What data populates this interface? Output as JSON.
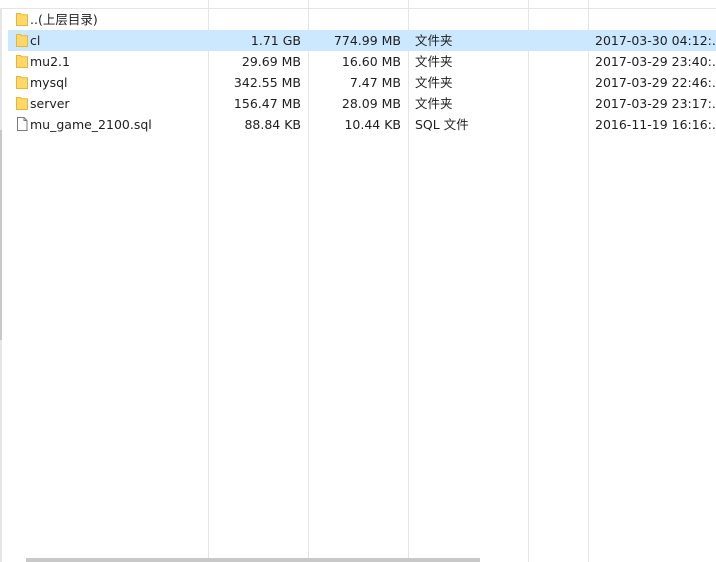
{
  "files": [
    {
      "name": "..(上层目录)",
      "size": "",
      "packed": "",
      "type": "",
      "modified": "",
      "icon": "folder-icon"
    },
    {
      "name": "cl",
      "size": "1.71 GB",
      "packed": "774.99 MB",
      "type": "文件夹",
      "modified": "2017-03-30 04:12:...",
      "icon": "folder-icon"
    },
    {
      "name": "mu2.1",
      "size": "29.69 MB",
      "packed": "16.60 MB",
      "type": "文件夹",
      "modified": "2017-03-29 23:40:...",
      "icon": "folder-icon"
    },
    {
      "name": "mysql",
      "size": "342.55 MB",
      "packed": "7.47 MB",
      "type": "文件夹",
      "modified": "2017-03-29 22:46:...",
      "icon": "folder-icon"
    },
    {
      "name": "server",
      "size": "156.47 MB",
      "packed": "28.09 MB",
      "type": "文件夹",
      "modified": "2017-03-29 23:17:...",
      "icon": "folder-icon"
    },
    {
      "name": "mu_game_2100.sql",
      "size": "88.84 KB",
      "packed": "10.44 KB",
      "type": "SQL 文件",
      "modified": "2016-11-19 16:16:...",
      "icon": "document-icon"
    }
  ],
  "colors": {
    "selection": "#cce8ff",
    "folder": "#ffd867",
    "folder_dark": "#e7b53e",
    "grid_line": "#e5e5e5"
  }
}
